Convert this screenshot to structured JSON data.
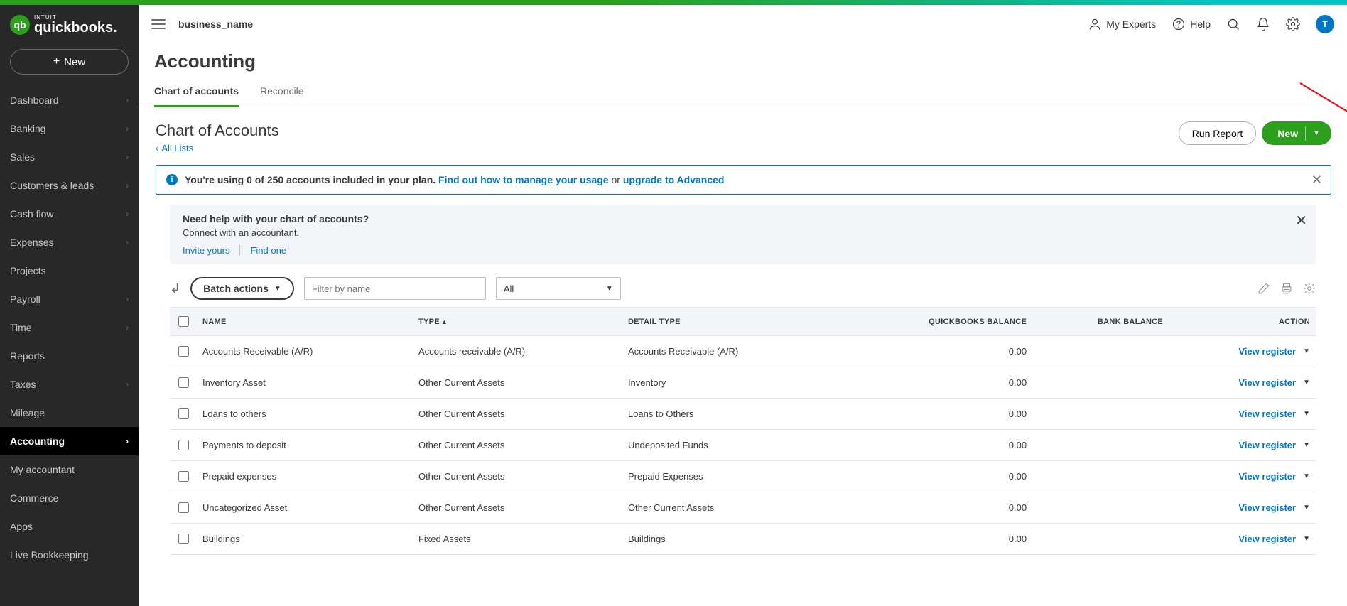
{
  "brand": {
    "intuit": "INTUIT",
    "name": "quickbooks.",
    "circle": "qb"
  },
  "sidebar": {
    "new_label": "New",
    "items": [
      {
        "label": "Dashboard",
        "chev": true
      },
      {
        "label": "Banking",
        "chev": true
      },
      {
        "label": "Sales",
        "chev": true
      },
      {
        "label": "Customers & leads",
        "chev": true
      },
      {
        "label": "Cash flow",
        "chev": true
      },
      {
        "label": "Expenses",
        "chev": true
      },
      {
        "label": "Projects",
        "chev": false
      },
      {
        "label": "Payroll",
        "chev": true
      },
      {
        "label": "Time",
        "chev": true
      },
      {
        "label": "Reports",
        "chev": false
      },
      {
        "label": "Taxes",
        "chev": true
      },
      {
        "label": "Mileage",
        "chev": false
      },
      {
        "label": "Accounting",
        "chev": true,
        "active": true
      },
      {
        "label": "My accountant",
        "chev": false
      },
      {
        "label": "Commerce",
        "chev": false
      },
      {
        "label": "Apps",
        "chev": false
      },
      {
        "label": "Live Bookkeeping",
        "chev": false
      }
    ]
  },
  "topbar": {
    "business": "business_name",
    "experts": "My Experts",
    "help": "Help",
    "avatar": "T"
  },
  "page": {
    "title": "Accounting",
    "tabs": [
      {
        "label": "Chart of accounts",
        "active": true
      },
      {
        "label": "Reconcile"
      }
    ],
    "subtitle": "Chart of Accounts",
    "back": "All Lists",
    "run_report": "Run Report",
    "new": "New"
  },
  "usage_banner": {
    "text": "You're using 0 of 250 accounts included in your plan. ",
    "link1": "Find out how to manage your usage",
    "or": " or ",
    "link2": "upgrade to Advanced"
  },
  "help_box": {
    "title": "Need help with your chart of accounts?",
    "sub": "Connect with an accountant.",
    "invite": "Invite yours",
    "find": "Find one"
  },
  "toolbar": {
    "batch": "Batch actions",
    "filter_placeholder": "Filter by name",
    "select_all": "All"
  },
  "table": {
    "headers": {
      "name": "NAME",
      "type": "TYPE",
      "detail": "DETAIL TYPE",
      "qb": "QUICKBOOKS BALANCE",
      "bank": "BANK BALANCE",
      "action": "ACTION"
    },
    "action_label": "View register",
    "rows": [
      {
        "name": "Accounts Receivable (A/R)",
        "type": "Accounts receivable (A/R)",
        "detail": "Accounts Receivable (A/R)",
        "qb": "0.00",
        "bank": ""
      },
      {
        "name": "Inventory Asset",
        "type": "Other Current Assets",
        "detail": "Inventory",
        "qb": "0.00",
        "bank": ""
      },
      {
        "name": "Loans to others",
        "type": "Other Current Assets",
        "detail": "Loans to Others",
        "qb": "0.00",
        "bank": ""
      },
      {
        "name": "Payments to deposit",
        "type": "Other Current Assets",
        "detail": "Undeposited Funds",
        "qb": "0.00",
        "bank": ""
      },
      {
        "name": "Prepaid expenses",
        "type": "Other Current Assets",
        "detail": "Prepaid Expenses",
        "qb": "0.00",
        "bank": ""
      },
      {
        "name": "Uncategorized Asset",
        "type": "Other Current Assets",
        "detail": "Other Current Assets",
        "qb": "0.00",
        "bank": ""
      },
      {
        "name": "Buildings",
        "type": "Fixed Assets",
        "detail": "Buildings",
        "qb": "0.00",
        "bank": ""
      }
    ]
  }
}
